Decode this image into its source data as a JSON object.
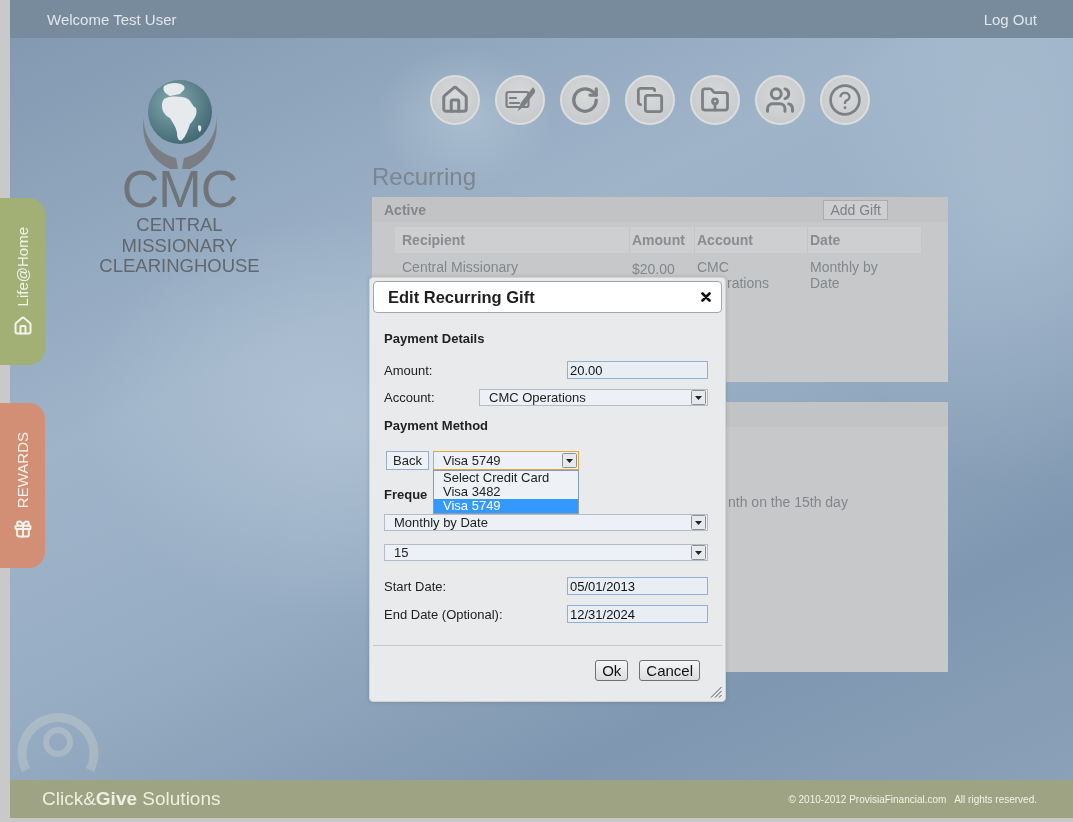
{
  "header": {
    "welcome": "Welcome Test User",
    "logout": "Log Out"
  },
  "logo": {
    "abbr": "CMC",
    "lines": [
      "CENTRAL",
      "MISSIONARY",
      "CLEARINGHOUSE"
    ]
  },
  "side_tabs": [
    {
      "label": "Life@Home",
      "kind": "home"
    },
    {
      "label": "REWARDS",
      "kind": "rewards"
    }
  ],
  "page_title": "Recurring",
  "active_panel": {
    "title": "Active",
    "add_button": "Add Gift",
    "columns": [
      "Recipient",
      "Amount",
      "Account",
      "Date"
    ],
    "rows": [
      {
        "recipient": "Central Missionary",
        "amount": "$20.00",
        "account": [
          "CMC",
          "rations"
        ],
        "date": "Monthly by Date"
      }
    ]
  },
  "detail_panel": {
    "text": "nth on the 15th day"
  },
  "dialog": {
    "title": "Edit Recurring Gift",
    "payment_details": {
      "heading": "Payment Details",
      "amount": {
        "label": "Amount:",
        "value": "20.00"
      },
      "account": {
        "label": "Account:",
        "value": "CMC Operations"
      }
    },
    "payment_method": {
      "heading": "Payment Method",
      "back_button": "Back",
      "card_select": {
        "value": "Visa 5749",
        "focused": true,
        "expanded": true,
        "options": [
          {
            "label": "Select Credit Card",
            "selected": false
          },
          {
            "label": "Visa 3482",
            "selected": false
          },
          {
            "label": "Visa 5749",
            "selected": true
          }
        ]
      }
    },
    "frequency": {
      "heading": "Freque",
      "schedule_select": "Monthly by Date",
      "day_select": "15"
    },
    "start_date": {
      "label": "Start Date:",
      "value": "05/01/2013"
    },
    "end_date": {
      "label": "End Date (Optional):",
      "value": "12/31/2024"
    },
    "buttons": [
      "Ok",
      "Cancel"
    ]
  },
  "footer": {
    "brand": "Click&**Give** Solutions",
    "copyright": "© 2010-2012 ProvisiaFinancial.com   All rights reserved."
  }
}
